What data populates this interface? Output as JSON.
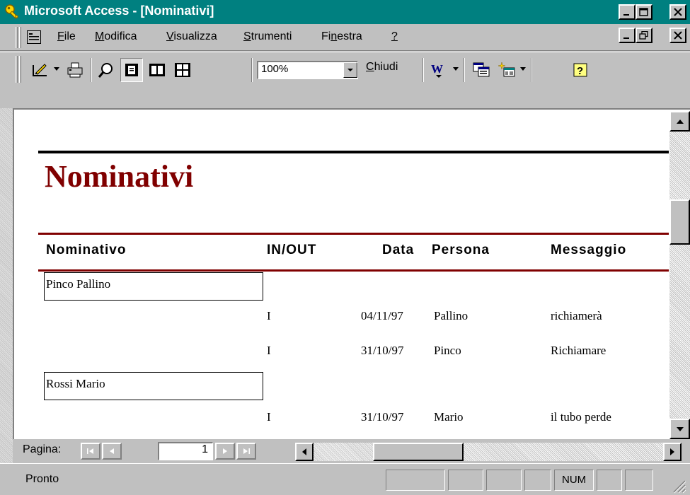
{
  "window": {
    "title": "Microsoft Access - [Nominativi]"
  },
  "menu": {
    "items": [
      {
        "pre": "",
        "acc": "F",
        "post": "ile"
      },
      {
        "pre": "",
        "acc": "M",
        "post": "odifica"
      },
      {
        "pre": "",
        "acc": "V",
        "post": "isualizza"
      },
      {
        "pre": "",
        "acc": "S",
        "post": "trumenti"
      },
      {
        "pre": "Fi",
        "acc": "n",
        "post": "estra"
      },
      {
        "pre": "",
        "acc": "?",
        "post": ""
      }
    ]
  },
  "toolbar": {
    "zoom_value": "100%",
    "close_pre": "",
    "close_acc": "C",
    "close_post": "hiudi"
  },
  "report": {
    "title": "Nominativi",
    "headers": {
      "nominativo": "Nominativo",
      "inout": "IN/OUT",
      "data": "Data",
      "persona": "Persona",
      "messaggio": "Messaggio"
    },
    "groups": [
      {
        "name": "Pinco Pallino",
        "rows": [
          {
            "inout": "I",
            "data": "04/11/97",
            "persona": "Pallino",
            "messaggio": "richiamerà"
          },
          {
            "inout": "I",
            "data": "31/10/97",
            "persona": "Pinco",
            "messaggio": "Richiamare"
          }
        ]
      },
      {
        "name": "Rossi Mario",
        "rows": [
          {
            "inout": "I",
            "data": "31/10/97",
            "persona": "Mario",
            "messaggio": "il tubo perde"
          }
        ]
      }
    ]
  },
  "navigation": {
    "page_label": "Pagina:",
    "page_number": "1"
  },
  "status": {
    "text": "Pronto",
    "num_indicator": "NUM"
  }
}
